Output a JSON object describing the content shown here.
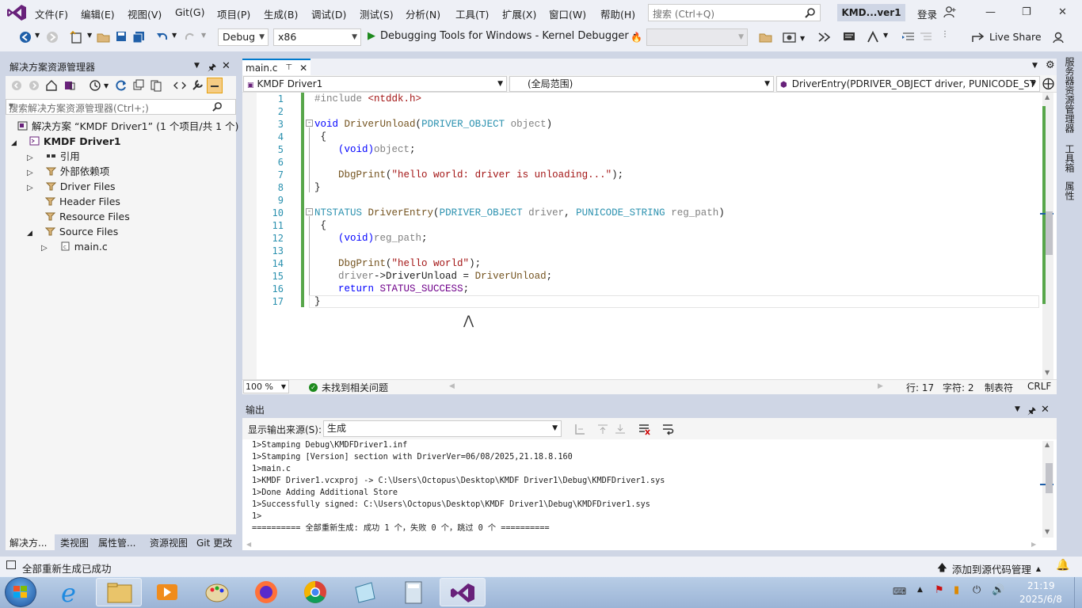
{
  "menubar": {
    "items": [
      "文件(F)",
      "编辑(E)",
      "视图(V)",
      "Git(G)",
      "项目(P)",
      "生成(B)",
      "调试(D)",
      "测试(S)",
      "分析(N)",
      "工具(T)",
      "扩展(X)",
      "窗口(W)",
      "帮助(H)"
    ],
    "search_placeholder": "搜索 (Ctrl+Q)",
    "solution_name": "KMD...ver1",
    "login": "登录"
  },
  "toolbar": {
    "config": "Debug",
    "platform": "x86",
    "run_target": "Debugging Tools for Windows - Kernel Debugger",
    "live_share": "Live Share"
  },
  "solution_explorer": {
    "title": "解决方案资源管理器",
    "search_placeholder": "搜索解决方案资源管理器(Ctrl+;)",
    "tree": [
      {
        "label": "解决方案 “KMDF Driver1” (1 个项目/共 1 个)"
      },
      {
        "label": "KMDF Driver1"
      },
      {
        "label": "引用"
      },
      {
        "label": "外部依赖项"
      },
      {
        "label": "Driver Files"
      },
      {
        "label": "Header Files"
      },
      {
        "label": "Resource Files"
      },
      {
        "label": "Source Files"
      },
      {
        "label": "main.c"
      }
    ],
    "bottom_tabs": [
      "解决方...",
      "类视图",
      "属性管...",
      "资源视图",
      "Git 更改"
    ]
  },
  "editor": {
    "tab_label": "main.c",
    "nav_project": "KMDF Driver1",
    "nav_scope": "(全局范围)",
    "nav_member": "DriverEntry(PDRIVER_OBJECT driver, PUNICODE_ST",
    "line_numbers": [
      "1",
      "2",
      "3",
      "4",
      "5",
      "6",
      "7",
      "8",
      "9",
      "10",
      "11",
      "12",
      "13",
      "14",
      "15",
      "16",
      "17"
    ],
    "code": {
      "l1_a": "#include ",
      "l1_b": "<ntddk.h>",
      "l3_a": "void",
      "l3_b": "DriverUnload",
      "l3_c": "(",
      "l3_d": "PDRIVER_OBJECT",
      "l3_e": "object",
      "l3_f": ")",
      "l4": "{",
      "l5_a": "(void)",
      "l5_b": "object",
      "l5_c": ";",
      "l7_a": "DbgPrint",
      "l7_b": "(",
      "l7_c": "\"hello world: driver is unloading...\"",
      "l7_d": ");",
      "l8": "}",
      "l10_a": "NTSTATUS",
      "l10_b": "DriverEntry",
      "l10_c": "(",
      "l10_d": "PDRIVER_OBJECT",
      "l10_e": "driver",
      "l10_f": ", ",
      "l10_g": "PUNICODE_STRING",
      "l10_h": "reg_path",
      "l10_i": ")",
      "l11": "{",
      "l12_a": "(void)",
      "l12_b": "reg_path",
      "l12_c": ";",
      "l14_a": "DbgPrint",
      "l14_b": "(",
      "l14_c": "\"hello world\"",
      "l14_d": ");",
      "l15_a": "driver",
      "l15_b": "->DriverUnload = ",
      "l15_c": "DriverUnload",
      "l15_d": ";",
      "l16_a": "return",
      "l16_b": "STATUS_SUCCESS",
      "l16_c": ";",
      "l17": "}"
    },
    "zoom": "100 %",
    "issues": "未找到相关问题",
    "line_pos": "行: 17",
    "char_pos": "字符: 2",
    "tab_mode": "制表符",
    "eol": "CRLF"
  },
  "output": {
    "title": "输出",
    "source_label": "显示输出来源(S):",
    "source_value": "生成",
    "lines": [
      "1>Stamping Debug\\KMDFDriver1.inf",
      "1>Stamping [Version] section with DriverVer=06/08/2025,21.18.8.160",
      "1>main.c",
      "1>KMDF Driver1.vcxproj -> C:\\Users\\Octopus\\Desktop\\KMDF Driver1\\Debug\\KMDFDriver1.sys",
      "1>Done Adding Additional Store",
      "1>Successfully signed: C:\\Users\\Octopus\\Desktop\\KMDF Driver1\\Debug\\KMDFDriver1.sys",
      "1>",
      "========== 全部重新生成: 成功 1 个，失败 0 个，跳过 0 个 =========="
    ]
  },
  "right_rail": [
    "服务器资源管理器",
    "工具箱",
    "属性"
  ],
  "statusbar": {
    "message": "全部重新生成已成功",
    "source_control": "添加到源代码管理"
  },
  "taskbar": {
    "time": "21:19",
    "date": "2025/6/8"
  },
  "colors": {
    "accent": "#007acc",
    "vs_purple": "#68217a",
    "change_bar": "#57a64a"
  }
}
